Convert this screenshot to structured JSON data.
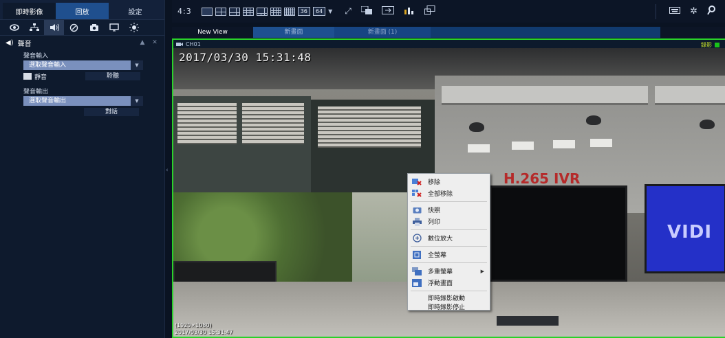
{
  "left_panel": {
    "main_tabs": [
      "即時影像",
      "回放",
      "設定"
    ],
    "icon_row": [
      "eye-icon",
      "network-icon",
      "speaker-icon",
      "clock-icon",
      "camera-icon",
      "monitor-icon",
      "brightness-icon"
    ],
    "section_title": "聲音",
    "audio_input": {
      "label": "聲音輸入",
      "select_value": "選取聲音輸入",
      "mute_label": "靜音",
      "listen_button": "聆聽"
    },
    "audio_output": {
      "label": "聲音輸出",
      "select_value": "選取聲音輸出",
      "talk_button": "對話"
    }
  },
  "toolbar": {
    "aspect": "4:3",
    "layout_36": "36",
    "layout_64": "64"
  },
  "view_tabs": [
    "New View",
    "新畫面",
    "新畫面 (1)"
  ],
  "video": {
    "channel": "CH01",
    "rec_label": "錄影",
    "osd_timestamp": "2017/03/30 15:31:48",
    "resolution": "(1920×1080)",
    "footer_timestamp": "2017/03/30 15:31:47",
    "sign_text": "H.265 IVR",
    "monitor_text": "VIDI"
  },
  "context_menu": {
    "items": [
      {
        "label": "移除",
        "icon": "remove-icon"
      },
      {
        "label": "全部移除",
        "icon": "remove-all-icon"
      },
      {
        "label": "快照",
        "icon": "snapshot-icon"
      },
      {
        "label": "列印",
        "icon": "print-icon"
      },
      {
        "label": "數位放大",
        "icon": "zoom-icon"
      },
      {
        "label": "全螢幕",
        "icon": "fullscreen-icon"
      },
      {
        "label": "多重螢幕",
        "icon": "multi-screen-icon"
      },
      {
        "label": "浮動畫面",
        "icon": "float-window-icon"
      },
      {
        "label": "即時錄影啟動",
        "icon": ""
      },
      {
        "label": "即時錄影停止",
        "icon": ""
      }
    ]
  },
  "colors": {
    "accent_blue": "#1f4f8e",
    "active_border": "#2ad12a",
    "select_bg": "#7a90bd"
  }
}
